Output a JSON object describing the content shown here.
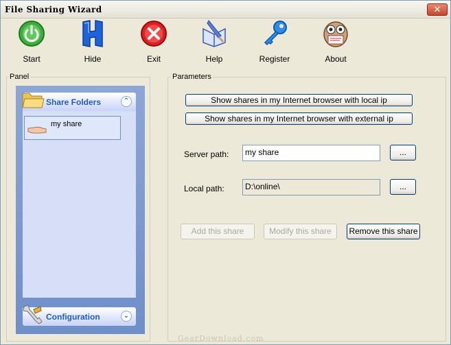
{
  "window": {
    "title": "File Sharing Wizard",
    "close_glyph": "✕"
  },
  "toolbar": {
    "items": [
      {
        "label": "Start",
        "icon": "power-icon"
      },
      {
        "label": "Hide",
        "icon": "hide-h-icon"
      },
      {
        "label": "Exit",
        "icon": "exit-x-icon"
      },
      {
        "label": "Help",
        "icon": "help-book-icon"
      },
      {
        "label": "Register",
        "icon": "key-icon"
      },
      {
        "label": "About",
        "icon": "owl-readme-icon"
      }
    ]
  },
  "panel": {
    "group_label": "Panel",
    "sections": [
      {
        "title": "Share Folders",
        "state": "expanded",
        "chevron": "⌃",
        "icon": "folder-icon"
      },
      {
        "title": "Configuration",
        "state": "collapsed",
        "chevron": "⌄",
        "icon": "wrench-icon"
      }
    ],
    "shares": [
      {
        "label": "my share",
        "icon": "sharing-hand-icon"
      }
    ]
  },
  "parameters": {
    "group_label": "Parameters",
    "show_local_label": "Show shares in my Internet browser with local ip",
    "show_external_label": "Show shares in my Internet browser with external ip",
    "server_path": {
      "label": "Server path:",
      "value": "my share",
      "browse_label": "..."
    },
    "local_path": {
      "label": "Local path:",
      "value": "D:\\online\\",
      "browse_label": "..."
    },
    "add_label": "Add this share",
    "modify_label": "Modify this share",
    "remove_label": "Remove this share"
  },
  "watermark": "GearDownload.com",
  "colors": {
    "accent": "#215dc6",
    "taskpane": "#7da2ce",
    "window_bg": "#ece9d8",
    "button_border": "#003c74"
  }
}
